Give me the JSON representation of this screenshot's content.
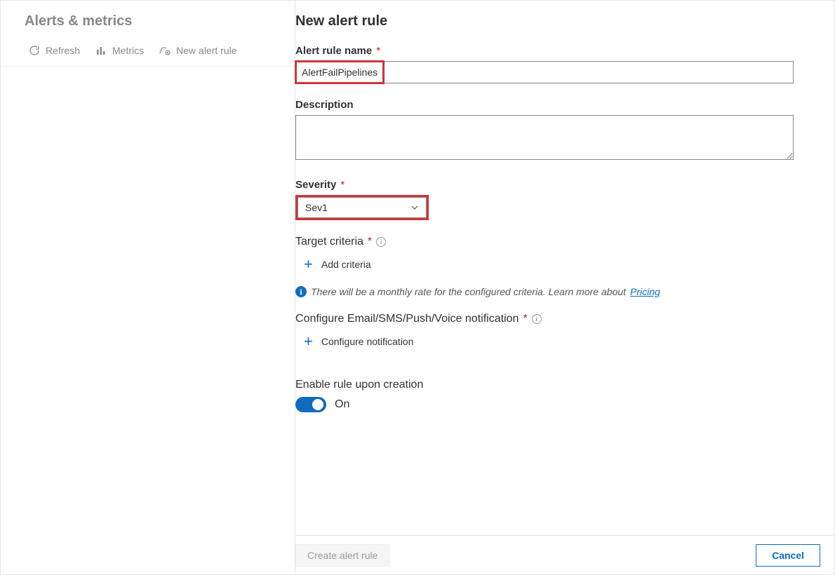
{
  "sidebar": {
    "title": "Alerts & metrics",
    "items": [
      {
        "label": "Refresh"
      },
      {
        "label": "Metrics"
      },
      {
        "label": "New alert rule"
      }
    ]
  },
  "page": {
    "title": "New alert rule",
    "alert_name_label": "Alert rule name",
    "alert_name_value": "AlertFailPipelines",
    "description_label": "Description",
    "description_value": "",
    "severity_label": "Severity",
    "severity_value": "Sev1",
    "target_label": "Target criteria",
    "add_criteria_label": "Add criteria",
    "info_text": "There will be a monthly rate for the configured criteria. Learn more about",
    "pricing_link": "Pricing",
    "notif_label": "Configure Email/SMS/Push/Voice notification",
    "configure_notif_label": "Configure notification",
    "enable_label": "Enable rule upon creation",
    "toggle_state": "On",
    "create_btn": "Create alert rule",
    "cancel_btn": "Cancel"
  }
}
